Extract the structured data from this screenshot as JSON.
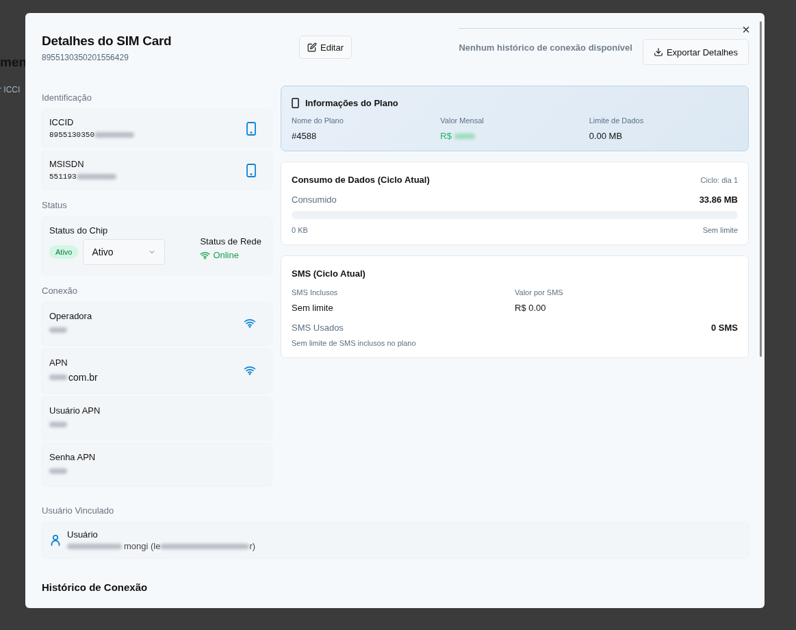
{
  "backdrop": {
    "heading": "men",
    "filter": "r ICCI"
  },
  "dialog": {
    "title": "Detalhes do SIM Card",
    "subtitle": "8955130350201556429",
    "edit_button": "Editar",
    "history_note": "Nenhum histórico de conexão disponível",
    "export_button": "Exportar Detalhes",
    "close": "×"
  },
  "identification": {
    "heading": "Identificação",
    "items": [
      {
        "label": "ICCID",
        "value": "8955130350",
        "redacted": true
      },
      {
        "label": "MSISDN",
        "value": "551193",
        "redacted": true
      }
    ]
  },
  "status": {
    "heading": "Status",
    "chip_label": "Status do Chip",
    "badge": "Ativo",
    "active": true,
    "select_value": "Ativo",
    "network_label": "Status de Rede",
    "network_value": "Online",
    "online": true
  },
  "connection": {
    "heading": "Conexão",
    "items": [
      {
        "label": "Operadora",
        "value": "",
        "redacted": true,
        "wifi": true
      },
      {
        "label": "APN",
        "value": "com.br",
        "redacted": true,
        "wifi": true
      },
      {
        "label": "Usuário APN",
        "value": "",
        "redacted": true,
        "wifi": false
      },
      {
        "label": "Senha APN",
        "value": "",
        "redacted": true,
        "wifi": false
      }
    ]
  },
  "linked_user": {
    "heading": "Usuário Vinculado",
    "label": "Usuário",
    "value": "mongi (le",
    "redacted": true,
    "tail": "r)"
  },
  "history": {
    "heading": "Histórico de Conexão"
  },
  "plan": {
    "title": "Informações do Plano",
    "fields": [
      {
        "label": "Nome do Plano",
        "value": "#4588",
        "kind": "plain"
      },
      {
        "label": "Valor Mensal",
        "value": "R$",
        "kind": "money"
      },
      {
        "label": "Limite de Dados",
        "value": "0.00 MB",
        "kind": "plain"
      }
    ]
  },
  "data_usage": {
    "title": "Consumo de Dados (Ciclo Atual)",
    "cycle": "Ciclo: dia 1",
    "consumed_label": "Consumido",
    "consumed_value": "33.86 MB",
    "level": 0,
    "min_label": "0 KB",
    "max_label": "Sem limite"
  },
  "sms": {
    "title": "SMS (Ciclo Atual)",
    "fields": [
      {
        "label": "SMS Inclusos",
        "value": "Sem limite"
      },
      {
        "label": "Valor por SMS",
        "value": "R$ 0.00"
      }
    ],
    "used_label": "SMS Usados",
    "used_value": "0 SMS",
    "note": "Sem limite de SMS inclusos no plano"
  }
}
